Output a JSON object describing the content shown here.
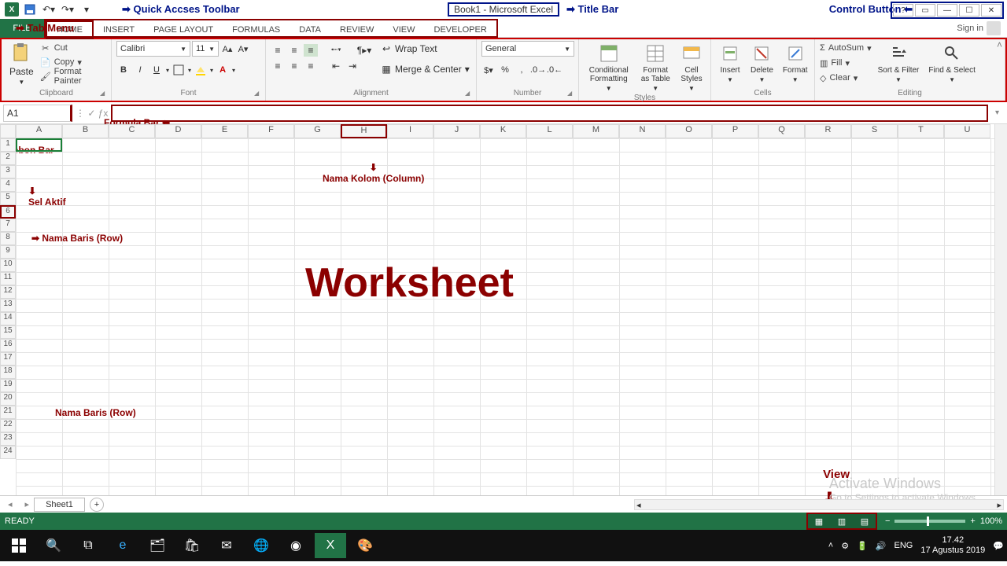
{
  "title": "Book1 - Microsoft Excel",
  "signin": "Sign in",
  "qat_arrow_label": "Quick Accses Toolbar",
  "titlebar_label": "Title Bar",
  "control_label": "Control Button",
  "tabs": {
    "file": "FILE",
    "home": "HOME",
    "insert": "INSERT",
    "pagelayout": "PAGE LAYOUT",
    "formulas": "FORMULAS",
    "data": "DATA",
    "review": "REVIEW",
    "view": "VIEW",
    "developer": "DEVELOPER"
  },
  "tabmenu_label": "Tab Menu",
  "clipboard": {
    "group": "Clipboard",
    "paste": "Paste",
    "cut": "Cut",
    "copy": "Copy",
    "fmtpainter": "Format Painter"
  },
  "font": {
    "group": "Font",
    "name": "Calibri",
    "size": "11",
    "bold": "B",
    "italic": "I",
    "underline": "U"
  },
  "alignment": {
    "group": "Alignment",
    "wrap": "Wrap Text",
    "merge": "Merge & Center"
  },
  "number": {
    "group": "Number",
    "format": "General"
  },
  "styles": {
    "group": "Styles",
    "cond": "Conditional Formatting",
    "astable": "Format as Table",
    "cellstyles": "Cell Styles"
  },
  "cells": {
    "group": "Cells",
    "insert": "Insert",
    "delete": "Delete",
    "format": "Format"
  },
  "editing": {
    "group": "Editing",
    "autosum": "AutoSum",
    "fill": "Fill",
    "clear": "Clear",
    "sort": "Sort & Filter",
    "find": "Find & Select"
  },
  "ribbon_label": "Ribbon Bar",
  "formula_label": "Formula Bar",
  "namebox_value": "A1",
  "columns": [
    "A",
    "B",
    "C",
    "D",
    "E",
    "F",
    "G",
    "H",
    "I",
    "J",
    "K",
    "L",
    "M",
    "N",
    "O",
    "P",
    "Q",
    "R",
    "S",
    "T",
    "U"
  ],
  "col_label": "Nama Kolom (Column)",
  "row_label": "Nama Baris (Row)",
  "row_label2": "Nama Baris (Row)",
  "active_label": "Sel Aktif",
  "worksheet_big": "Worksheet",
  "view_anno": "View",
  "sheet1": "Sheet1",
  "ready": "READY",
  "zoom": "100%",
  "watermark": {
    "l1": "Activate Windows",
    "l2": "Go to Settings to activate Windows"
  },
  "taskbar": {
    "lang": "ENG",
    "time": "17.42",
    "date": "17 Agustus 2019"
  }
}
